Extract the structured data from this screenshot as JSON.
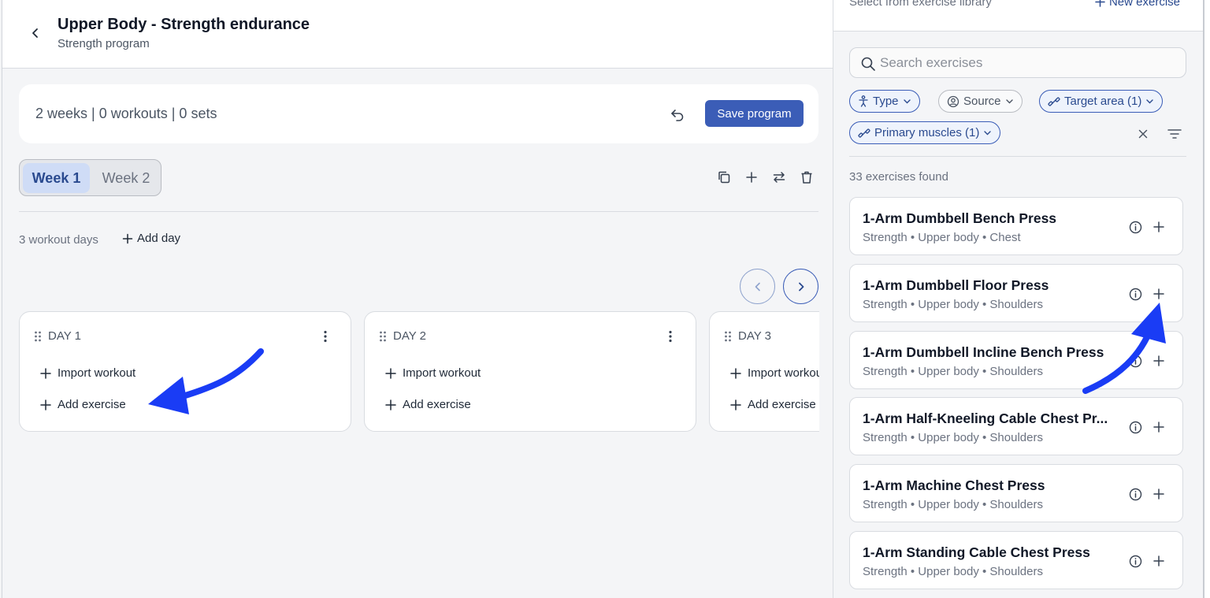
{
  "header": {
    "title": "Upper Body - Strength endurance",
    "subtitle": "Strength program"
  },
  "summary": {
    "text": "2 weeks | 0 workouts | 0 sets",
    "save_label": "Save program"
  },
  "weeks": {
    "tabs": [
      {
        "label": "Week 1",
        "active": true
      },
      {
        "label": "Week 2",
        "active": false
      }
    ]
  },
  "days_bar": {
    "count_text": "3 workout days",
    "add_day_label": "Add day"
  },
  "days": [
    {
      "label": "DAY 1",
      "import_label": "Import workout",
      "add_label": "Add exercise"
    },
    {
      "label": "DAY 2",
      "import_label": "Import workout",
      "add_label": "Add exercise"
    },
    {
      "label": "DAY 3",
      "import_label": "Import workout",
      "add_label": "Add exercise"
    }
  ],
  "panel": {
    "top_text": "Select from exercise library",
    "new_exercise_label": "New exercise",
    "search_placeholder": "Search exercises",
    "filters": [
      {
        "label": "Type"
      },
      {
        "label": "Source"
      },
      {
        "label": "Target area (1)"
      },
      {
        "label": "Primary muscles (1)"
      }
    ],
    "found_text": "33 exercises found",
    "exercises": [
      {
        "name": "1-Arm Dumbbell Bench Press",
        "meta": "Strength • Upper body • Chest"
      },
      {
        "name": "1-Arm Dumbbell Floor Press",
        "meta": "Strength • Upper body • Shoulders"
      },
      {
        "name": "1-Arm Dumbbell Incline Bench Press",
        "meta": "Strength • Upper body • Shoulders"
      },
      {
        "name": "1-Arm Half-Kneeling Cable Chest Pr...",
        "meta": "Strength • Upper body • Shoulders"
      },
      {
        "name": "1-Arm Machine Chest Press",
        "meta": "Strength • Upper body • Shoulders"
      },
      {
        "name": "1-Arm Standing Cable Chest Press",
        "meta": "Strength • Upper body • Shoulders"
      }
    ]
  },
  "colors": {
    "accent": "#3b5db7",
    "accent_text": "#2a4a8f",
    "annotation_arrow": "#1a3cf5"
  },
  "icons": [
    "chevron-left-icon",
    "undo-icon",
    "copy-icon",
    "plus-icon",
    "swap-icon",
    "trash-icon",
    "chevron-right-icon",
    "drag-handle-icon",
    "more-vertical-icon",
    "search-icon",
    "person-icon",
    "user-circle-icon",
    "dumbbell-icon",
    "close-icon",
    "filter-lines-icon",
    "info-icon",
    "arrow-annotation-icon"
  ]
}
